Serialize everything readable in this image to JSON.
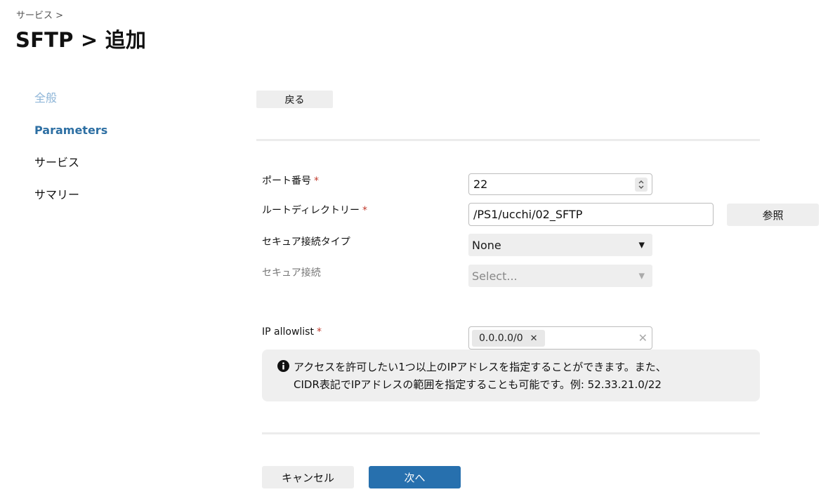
{
  "breadcrumb": "サービス >",
  "page_title": "SFTP > 追加",
  "sidebar": {
    "items": [
      {
        "label": "全般"
      },
      {
        "label": "Parameters"
      },
      {
        "label": "サービス"
      },
      {
        "label": "サマリー"
      }
    ]
  },
  "toolbar": {
    "back_label": "戻る"
  },
  "form": {
    "port": {
      "label": "ポート番号",
      "required": "*",
      "value": "22"
    },
    "root_dir": {
      "label": "ルートディレクトリー",
      "required": "*",
      "value": "/PS1/ucchi/02_SFTP",
      "browse_label": "参照"
    },
    "secure_type": {
      "label": "セキュア接続タイプ",
      "value": "None"
    },
    "secure_conn": {
      "label": "セキュア接続",
      "placeholder": "Select..."
    },
    "ip_allowlist": {
      "label": "IP allowlist",
      "required": "*",
      "tags": [
        "0.0.0.0/0"
      ],
      "help_line1": "アクセスを許可したい1つ以上のIPアドレスを指定することができます。また、",
      "help_line2": "CIDR表記でIPアドレスの範囲を指定することも可能です。例: 52.33.21.0/22"
    }
  },
  "footer": {
    "cancel_label": "キャンセル",
    "next_label": "次へ"
  },
  "colors": {
    "accent": "#2770ae",
    "active_nav": "#2d6fa3",
    "done_nav": "#8fb6d8",
    "required": "#c0392b"
  }
}
